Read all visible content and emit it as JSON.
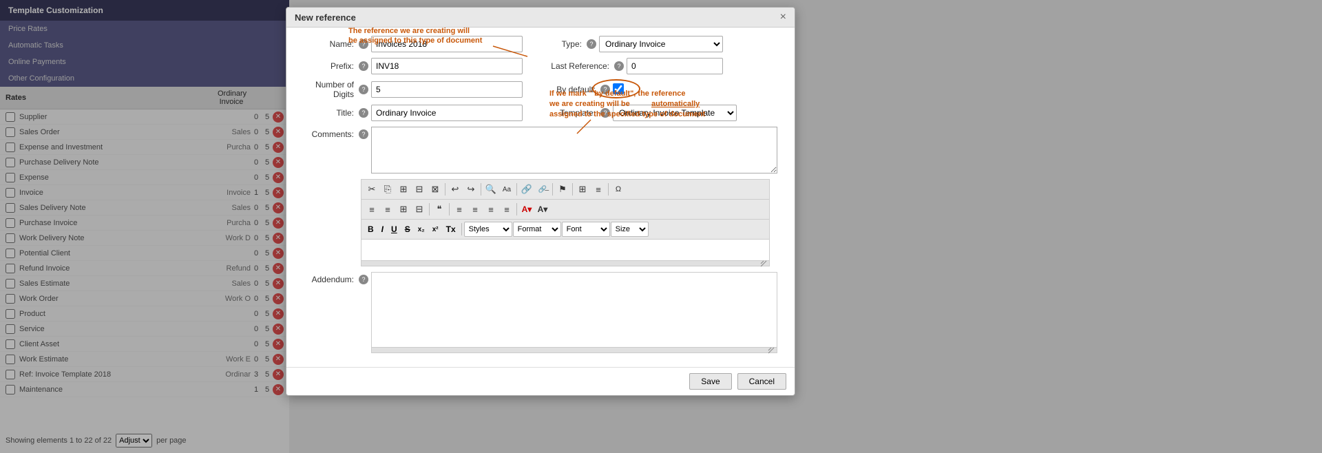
{
  "sidebar": {
    "title": "Template Customization",
    "menu_items": [
      {
        "label": "Price Rates"
      },
      {
        "label": "Automatic Tasks"
      },
      {
        "label": "Online Payments"
      },
      {
        "label": "Other Configuration"
      }
    ],
    "rows": [
      {
        "label": "Supplier",
        "type": "",
        "col1": "0",
        "col2": "5"
      },
      {
        "label": "Sales Order",
        "type": "Sales",
        "col1": "0",
        "col2": "5"
      },
      {
        "label": "Expense and Investment",
        "type": "Purcha",
        "col1": "0",
        "col2": "5"
      },
      {
        "label": "Purchase Delivery Note",
        "type": "",
        "col1": "0",
        "col2": "5"
      },
      {
        "label": "Expense",
        "type": "",
        "col1": "0",
        "col2": "5"
      },
      {
        "label": "Invoice",
        "type": "Invoice",
        "col1": "1",
        "col2": "5"
      },
      {
        "label": "Sales Delivery Note",
        "type": "Sales",
        "col1": "0",
        "col2": "5"
      },
      {
        "label": "Purchase Invoice",
        "type": "Purcha",
        "col1": "0",
        "col2": "5"
      },
      {
        "label": "Work Delivery Note",
        "type": "Work D",
        "col1": "0",
        "col2": "5"
      },
      {
        "label": "Potential Client",
        "type": "",
        "col1": "0",
        "col2": "5"
      },
      {
        "label": "Refund Invoice",
        "type": "Refund",
        "col1": "0",
        "col2": "5"
      },
      {
        "label": "Sales Estimate",
        "type": "Sales",
        "col1": "0",
        "col2": "5"
      },
      {
        "label": "Work Order",
        "type": "Work O",
        "col1": "0",
        "col2": "5"
      },
      {
        "label": "Product",
        "type": "",
        "col1": "0",
        "col2": "5"
      },
      {
        "label": "Service",
        "type": "",
        "col1": "0",
        "col2": "5"
      },
      {
        "label": "Client Asset",
        "type": "",
        "col1": "0",
        "col2": "5"
      },
      {
        "label": "Work Estimate",
        "type": "Work E",
        "col1": "0",
        "col2": "5"
      },
      {
        "label": "Ref: Invoice Template 2018",
        "type": "Ordinar",
        "col1": "3",
        "col2": "5"
      },
      {
        "label": "Maintenance",
        "type": "",
        "col1": "1",
        "col2": "5"
      }
    ],
    "footer": "Showing elements 1 to 22 of 22",
    "adjust_label": "Adjust",
    "per_page_label": "per page"
  },
  "modal": {
    "title": "New reference",
    "close_label": "×",
    "annotation_top": "The reference we are creating will be assigned to this type of document",
    "annotation_mid": "If we mark \" by default\", the reference we are creating will be automatically assigned to the specified type of document",
    "fields": {
      "name_label": "Name:",
      "name_help": "?",
      "name_value": "Invoices 2018",
      "type_label": "Type:",
      "type_help": "?",
      "type_value": "Ordinary Invoice",
      "prefix_label": "Prefix:",
      "prefix_help": "?",
      "prefix_value": "INV18",
      "last_ref_label": "Last Reference:",
      "last_ref_help": "?",
      "last_ref_value": "0",
      "digits_label": "Number of Digits",
      "digits_help": "?",
      "digits_value": "5",
      "by_default_label": "By default:",
      "by_default_help": "?",
      "title_label": "Title:",
      "title_help": "?",
      "title_value": "Ordinary Invoice",
      "template_label": "Template:",
      "template_help": "?",
      "template_value": "Ordinary Invoice Template",
      "comments_label": "Comments:",
      "comments_help": "?",
      "addendum_label": "Addendum:",
      "addendum_help": "?"
    },
    "toolbar": {
      "row1": [
        "✂",
        "⎘",
        "⊞",
        "⊟",
        "⊠",
        "←",
        "→",
        "🔍",
        "Aa",
        "🔗",
        "🔗",
        "⚑",
        "⊞",
        "≡",
        "Ω"
      ],
      "row2": [
        "≡",
        "≡",
        "⊞",
        "⊞",
        "❝",
        "≡",
        "≡",
        "≡",
        "≡",
        "A▾",
        "A▾"
      ],
      "row3_dropdowns": [
        "Styles",
        "Format",
        "Font",
        "Size"
      ],
      "row3_buttons": [
        "B",
        "I",
        "U",
        "S",
        "x₂",
        "x²",
        "Tx"
      ]
    },
    "save_label": "Save",
    "cancel_label": "Cancel"
  }
}
